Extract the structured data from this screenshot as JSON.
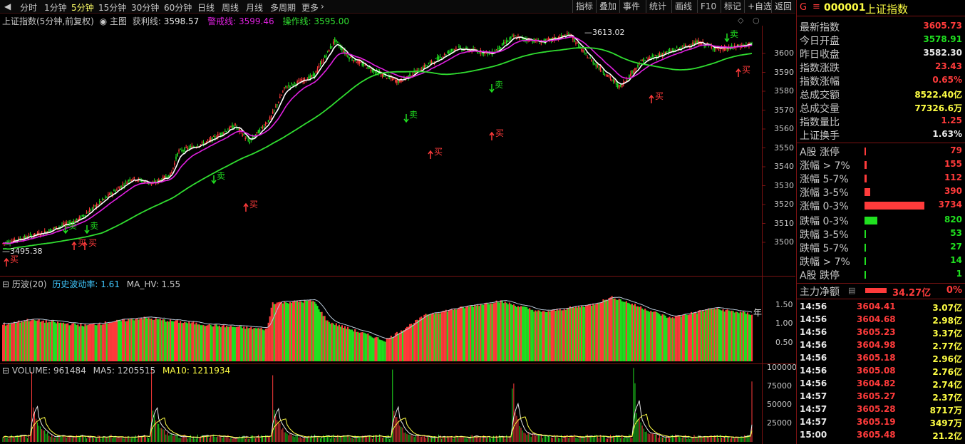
{
  "toolbar": {
    "periods": [
      "分时",
      "1分钟",
      "5分钟",
      "15分钟",
      "30分钟",
      "60分钟",
      "日线",
      "周线",
      "月线",
      "多周期",
      "更多"
    ],
    "active_period": "5分钟",
    "tools": [
      "指标",
      "叠加",
      "事件",
      "统计",
      "画线",
      "F10",
      "标记",
      "+自选",
      "返回"
    ]
  },
  "main_chart": {
    "title": "上证指数(5分钟,前复权)",
    "indicator": "主图",
    "profit_line_label": "获利线:",
    "profit_line_value": "3598.57",
    "warning_line_label": "警戒线:",
    "warning_line_value": "3599.46",
    "operate_line_label": "操作线:",
    "operate_line_value": "3595.00",
    "high_marker": "3613.02",
    "low_marker": "3495.38",
    "y_ticks": [
      "3600",
      "3590",
      "3580",
      "3570",
      "3560",
      "3550",
      "3540",
      "3530",
      "3520",
      "3510",
      "3500"
    ],
    "buy_label": "买",
    "sell_label": "卖",
    "colors": {
      "up": "#ff3b3b",
      "down": "#20e020",
      "profit": "#ffffff",
      "warning": "#e020e0",
      "operate": "#30dd30"
    }
  },
  "volatility_chart": {
    "title": "历波(20)",
    "hv_label": "历史波动率:",
    "hv_value": "1.61",
    "ma_label": "MA_HV:",
    "ma_value": "1.55",
    "y_ticks": [
      "1.50",
      "1.00",
      "0.50"
    ],
    "edge_label": "年"
  },
  "volume_chart": {
    "vol_label": "VOLUME:",
    "vol_value": "961484",
    "ma5_label": "MA5:",
    "ma5_value": "1205515",
    "ma10_label": "MA10:",
    "ma10_value": "1211934",
    "y_ticks": [
      "100000",
      "75000",
      "50000",
      "25000"
    ]
  },
  "quote_panel": {
    "code": "000001",
    "name": "上证指数",
    "rows": [
      {
        "label": "最新指数",
        "value": "3605.73",
        "color": "red"
      },
      {
        "label": "今日开盘",
        "value": "3578.91",
        "color": "green"
      },
      {
        "label": "昨日收盘",
        "value": "3582.30",
        "color": "white"
      },
      {
        "label": "指数涨跌",
        "value": "23.43",
        "color": "red"
      },
      {
        "label": "指数涨幅",
        "value": "0.65%",
        "color": "red"
      },
      {
        "label": "总成交额",
        "value": "8522.40亿",
        "color": "yellow"
      },
      {
        "label": "总成交量",
        "value": "77326.6万",
        "color": "yellow"
      },
      {
        "label": "指数量比",
        "value": "1.25",
        "color": "red"
      },
      {
        "label": "上证换手",
        "value": "1.63%",
        "color": "white"
      }
    ],
    "breadth": [
      {
        "label": "A股 涨停",
        "value": "79",
        "dir": "up",
        "ratio": 0.0
      },
      {
        "label": "涨幅 > 7%",
        "value": "155",
        "dir": "up",
        "ratio": 0.04
      },
      {
        "label": "涨幅 5-7%",
        "value": "112",
        "dir": "up",
        "ratio": 0.03
      },
      {
        "label": "涨幅 3-5%",
        "value": "390",
        "dir": "up",
        "ratio": 0.1
      },
      {
        "label": "涨幅 0-3%",
        "value": "3734",
        "dir": "up",
        "ratio": 1.0
      },
      {
        "label": "跌幅 0-3%",
        "value": "820",
        "dir": "down",
        "ratio": 0.22
      },
      {
        "label": "跌幅 3-5%",
        "value": "53",
        "dir": "down",
        "ratio": 0.0
      },
      {
        "label": "跌幅 5-7%",
        "value": "27",
        "dir": "down",
        "ratio": 0.0
      },
      {
        "label": "跌幅 > 7%",
        "value": "14",
        "dir": "down",
        "ratio": 0.0
      },
      {
        "label": "A股 跌停",
        "value": "1",
        "dir": "down",
        "ratio": 0.0
      }
    ],
    "net_inflow_label": "主力净额",
    "net_inflow_value": "34.27亿",
    "net_inflow_pct": "0%",
    "ticks": [
      {
        "time": "14:56",
        "price": "3604.41",
        "amount": "3.07亿"
      },
      {
        "time": "14:56",
        "price": "3604.68",
        "amount": "2.98亿"
      },
      {
        "time": "14:56",
        "price": "3605.23",
        "amount": "3.37亿"
      },
      {
        "time": "14:56",
        "price": "3604.98",
        "amount": "2.77亿"
      },
      {
        "time": "14:56",
        "price": "3605.18",
        "amount": "2.96亿"
      },
      {
        "time": "14:56",
        "price": "3605.08",
        "amount": "2.76亿"
      },
      {
        "time": "14:56",
        "price": "3604.82",
        "amount": "2.74亿"
      },
      {
        "time": "14:57",
        "price": "3605.27",
        "amount": "2.37亿"
      },
      {
        "time": "14:57",
        "price": "3605.28",
        "amount": "8717万"
      },
      {
        "time": "14:57",
        "price": "3605.19",
        "amount": "3497万"
      },
      {
        "time": "15:00",
        "price": "3605.48",
        "amount": "21.2亿"
      }
    ]
  }
}
